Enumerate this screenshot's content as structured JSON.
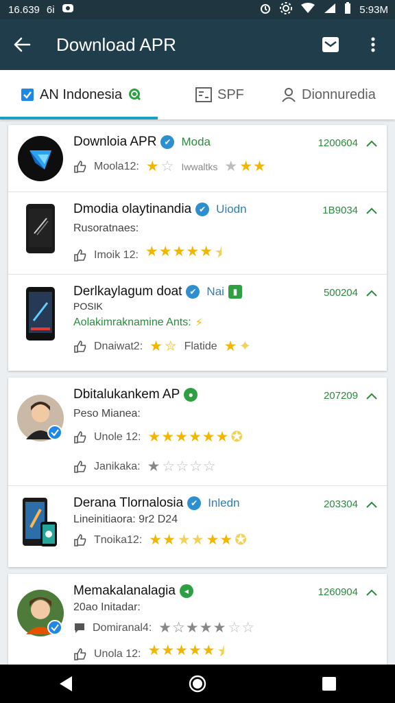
{
  "status": {
    "left_text": "16.639",
    "left_extra": "6i",
    "time": "5:93M"
  },
  "header": {
    "title": "Download APR"
  },
  "tabs": [
    {
      "label": "AN Indonesia"
    },
    {
      "label": "SPF"
    },
    {
      "label": "Dionnuredia"
    }
  ],
  "items": [
    {
      "title": "Downloia APR",
      "badge": "Moda",
      "count": "1200604",
      "rating_label": "Moola12:",
      "rating_tail": "Iwwaltks",
      "stars": 2
    },
    {
      "title": "Dmodia olaytinandia",
      "badge": "Uiodn",
      "count": "1B9034",
      "sub": "Rusoratnaes:",
      "rating_label": "Imoik 12:",
      "stars": 5
    },
    {
      "title": "Derlkaylagum doat",
      "badge": "Nai",
      "sub_top": "POSIK",
      "sub": "Aolakimraknamine Ants:",
      "count": "500204",
      "rating_label": "Dnaiwat2:",
      "rating_tail": "Flatide",
      "stars": 3
    },
    {
      "title": "Dbitalukankem AP",
      "count": "207209",
      "sub": "Peso Mianea:",
      "rating_label": "Unole 12:",
      "rating_label_2": "Janikaka:",
      "stars": 7,
      "stars_2": 1
    },
    {
      "title": "Derana Tlornalosia",
      "badge": "Inledn",
      "count": "203304",
      "sub": "Lineinitiaora: 9r2 D24",
      "rating_label": "Tnoika12:",
      "stars": 7
    },
    {
      "title": "Memakalanalagia",
      "count": "1260904",
      "sub": "20ao Initadar:",
      "rating_label": "Domiranal4:",
      "rating_label_2": "Unola 12:",
      "stars": 4,
      "stars_2": 5
    }
  ],
  "colors": {
    "appbar": "#1f3d4b",
    "accent": "#1ba0c4",
    "green": "#2b8a3e",
    "star": "#f2b600"
  }
}
